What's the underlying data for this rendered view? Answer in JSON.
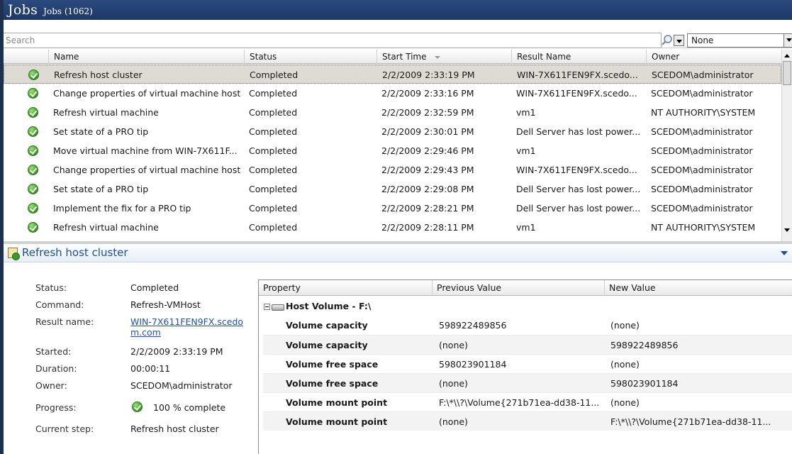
{
  "window": {
    "title": "Jobs",
    "subtitle": "Jobs (1062)"
  },
  "search": {
    "placeholder": "Search",
    "filter_value": "None"
  },
  "grid": {
    "columns": [
      "Name",
      "Status",
      "Start Time",
      "Result Name",
      "Owner"
    ],
    "rows": [
      {
        "name": "Refresh host cluster",
        "status": "Completed",
        "start": "2/2/2009 2:33:19 PM",
        "result": "WIN-7X611FEN9FX.scedo...",
        "owner": "SCEDOM\\administrator"
      },
      {
        "name": "Change properties of virtual machine host",
        "status": "Completed",
        "start": "2/2/2009 2:33:16 PM",
        "result": "WIN-7X611FEN9FX.scedo...",
        "owner": "SCEDOM\\administrator"
      },
      {
        "name": "Refresh virtual machine",
        "status": "Completed",
        "start": "2/2/2009 2:32:59 PM",
        "result": "vm1",
        "owner": "NT AUTHORITY\\SYSTEM"
      },
      {
        "name": "Set state of a PRO tip",
        "status": "Completed",
        "start": "2/2/2009 2:30:01 PM",
        "result": "Dell Server has lost power...",
        "owner": "SCEDOM\\administrator"
      },
      {
        "name": "Move virtual machine from WIN-7X611F...",
        "status": "Completed",
        "start": "2/2/2009 2:29:46 PM",
        "result": "vm1",
        "owner": "SCEDOM\\administrator"
      },
      {
        "name": "Change properties of virtual machine host",
        "status": "Completed",
        "start": "2/2/2009 2:29:43 PM",
        "result": "WIN-7X611FEN9FX.scedo...",
        "owner": "SCEDOM\\administrator"
      },
      {
        "name": "Set state of a PRO tip",
        "status": "Completed",
        "start": "2/2/2009 2:29:08 PM",
        "result": "Dell Server has lost power...",
        "owner": "SCEDOM\\administrator"
      },
      {
        "name": "Implement the fix for a PRO tip",
        "status": "Completed",
        "start": "2/2/2009 2:28:21 PM",
        "result": "Dell Server has lost power...",
        "owner": "SCEDOM\\administrator"
      },
      {
        "name": "Refresh virtual machine",
        "status": "Completed",
        "start": "2/2/2009 2:28:11 PM",
        "result": "vm1",
        "owner": "NT AUTHORITY\\SYSTEM"
      }
    ]
  },
  "details": {
    "title": "Refresh host cluster",
    "labels": {
      "status": "Status:",
      "command": "Command:",
      "result_name": "Result name:",
      "started": "Started:",
      "duration": "Duration:",
      "owner": "Owner:",
      "progress": "Progress:",
      "current_step": "Current step:"
    },
    "values": {
      "status": "Completed",
      "command": "Refresh-VMHost",
      "result_name": "WIN-7X611FEN9FX.scedom.com",
      "started": "2/2/2009 2:33:19 PM",
      "duration": "00:00:11",
      "owner": "SCEDOM\\administrator",
      "progress": "100 % complete",
      "current_step": "Refresh host cluster"
    },
    "progress_fraction": 1.0
  },
  "changes": {
    "columns": [
      "Property",
      "Previous Value",
      "New Value"
    ],
    "group": "Host Volume - F:\\",
    "rows": [
      {
        "property": "Volume capacity",
        "previous": "598922489856",
        "new": "(none)"
      },
      {
        "property": "Volume capacity",
        "previous": "(none)",
        "new": "598922489856"
      },
      {
        "property": "Volume free space",
        "previous": "598023901184",
        "new": "(none)"
      },
      {
        "property": "Volume free space",
        "previous": "(none)",
        "new": "598023901184"
      },
      {
        "property": "Volume mount point",
        "previous": "F:\\*\\\\?\\Volume{271b71ea-dd38-11...",
        "new": "(none)"
      },
      {
        "property": "Volume mount point",
        "previous": "(none)",
        "new": "F:\\*\\\\?\\Volume{271b71ea-dd38-11..."
      }
    ]
  },
  "colors": {
    "title_bar": "#1d3866",
    "selected_row": "#dedad4",
    "link": "#1f4fc0",
    "success": "#3c9a22"
  }
}
